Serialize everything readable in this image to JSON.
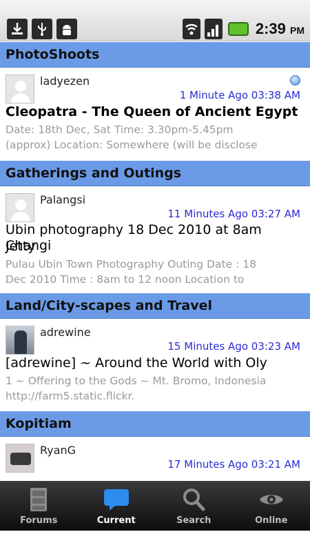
{
  "status_bar": {
    "time": "2:39",
    "ampm": "PM",
    "left_icons": [
      "download-icon",
      "usb-icon",
      "android-debug-icon"
    ],
    "right_icons": [
      "wifi-icon",
      "signal-icon",
      "battery-icon"
    ]
  },
  "sections": [
    {
      "header": "PhotoShoots",
      "post": {
        "username": "ladyezen",
        "time": "1 Minute Ago 03:38 AM",
        "title": "Cleopatra - The Queen of Ancient Egypt",
        "snippet_line1": "Date: 18th Dec, Sat  Time: 3.30pm-5.45pm",
        "snippet_line2": "(approx)  Location: Somewhere (will be disclose"
      }
    },
    {
      "header": "Gatherings and Outings",
      "post": {
        "username": "Palangsi",
        "time": "11 Minutes Ago 03:27 AM",
        "title_line1": "Ubin photography 18 Dec 2010 at 8am Changi",
        "title_line2": "Jetty",
        "snippet_line1": "Pulau Ubin Town Photography Outing  Date : 18",
        "snippet_line2": "Dec 2010  Time : 8am to 12 noon Location to"
      }
    },
    {
      "header": "Land/City-scapes and Travel",
      "post": {
        "username": "adrewine",
        "time": "15 Minutes Ago 03:23 AM",
        "title": "[adrewine] ~ Around the World with Oly",
        "snippet_line1": "1 ~ Offering to the Gods ~ Mt. Bromo, Indonesia",
        "snippet_line2": "http://farm5.static.flickr."
      }
    },
    {
      "header": "Kopitiam",
      "post": {
        "username": "RyanG",
        "time": "17 Minutes Ago 03:21 AM"
      }
    }
  ],
  "tabs": [
    {
      "label": "Forums",
      "icon": "cabinet-icon",
      "active": false
    },
    {
      "label": "Current",
      "icon": "speech-bubble-icon",
      "active": true
    },
    {
      "label": "Search",
      "icon": "magnifier-icon",
      "active": false
    },
    {
      "label": "Online",
      "icon": "eye-icon",
      "active": false
    }
  ]
}
